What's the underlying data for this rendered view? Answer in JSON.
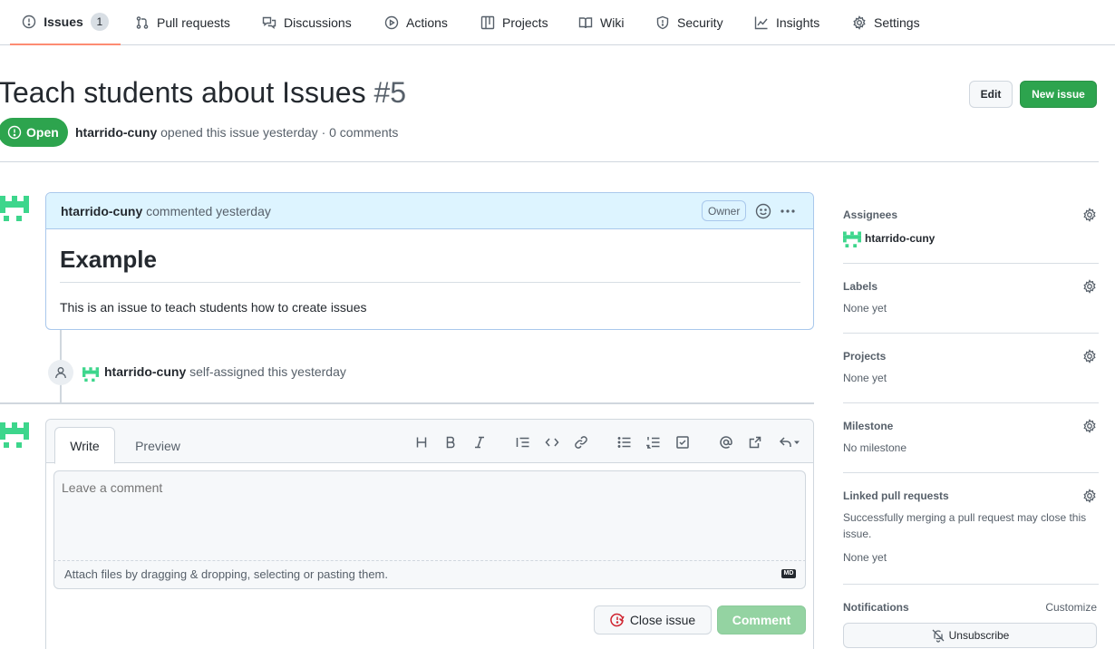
{
  "nav": {
    "tabs": [
      {
        "label": "Issues",
        "count": "1",
        "icon": "issue-opened-icon"
      },
      {
        "label": "Pull requests",
        "icon": "git-pull-request-icon"
      },
      {
        "label": "Discussions",
        "icon": "comment-discussion-icon"
      },
      {
        "label": "Actions",
        "icon": "play-icon"
      },
      {
        "label": "Projects",
        "icon": "table-icon"
      },
      {
        "label": "Wiki",
        "icon": "book-icon"
      },
      {
        "label": "Security",
        "icon": "shield-icon"
      },
      {
        "label": "Insights",
        "icon": "graph-icon"
      },
      {
        "label": "Settings",
        "icon": "gear-icon"
      }
    ]
  },
  "issue": {
    "title": "Teach students about Issues",
    "number": "#5",
    "state": "Open",
    "author": "htarrido-cuny",
    "meta_rest": "opened this issue yesterday · 0 comments"
  },
  "header_buttons": {
    "edit": "Edit",
    "new_issue": "New issue"
  },
  "comment": {
    "author": "htarrido-cuny",
    "action": "commented yesterday",
    "badge": "Owner",
    "heading": "Example",
    "body": "This is an issue to teach students how to create issues"
  },
  "event": {
    "author": "htarrido-cuny",
    "text": "self-assigned this yesterday"
  },
  "editor": {
    "tab_write": "Write",
    "tab_preview": "Preview",
    "placeholder": "Leave a comment",
    "attach_hint": "Attach files by dragging & dropping, selecting or pasting them.",
    "md_badge": "MD",
    "close_button": "Close issue",
    "comment_button": "Comment"
  },
  "sidebar": {
    "assignees": {
      "title": "Assignees",
      "user": "htarrido-cuny"
    },
    "labels": {
      "title": "Labels",
      "value": "None yet"
    },
    "projects": {
      "title": "Projects",
      "value": "None yet"
    },
    "milestone": {
      "title": "Milestone",
      "value": "No milestone"
    },
    "linked_prs": {
      "title": "Linked pull requests",
      "desc": "Successfully merging a pull request may close this issue.",
      "value": "None yet"
    },
    "notifications": {
      "title": "Notifications",
      "customize": "Customize",
      "unsubscribe": "Unsubscribe"
    }
  },
  "colors": {
    "accent_green": "#2da44e",
    "tab_underline": "#fd8c73",
    "comment_header_bg": "#ddf4ff",
    "close_red": "#cf222e"
  }
}
